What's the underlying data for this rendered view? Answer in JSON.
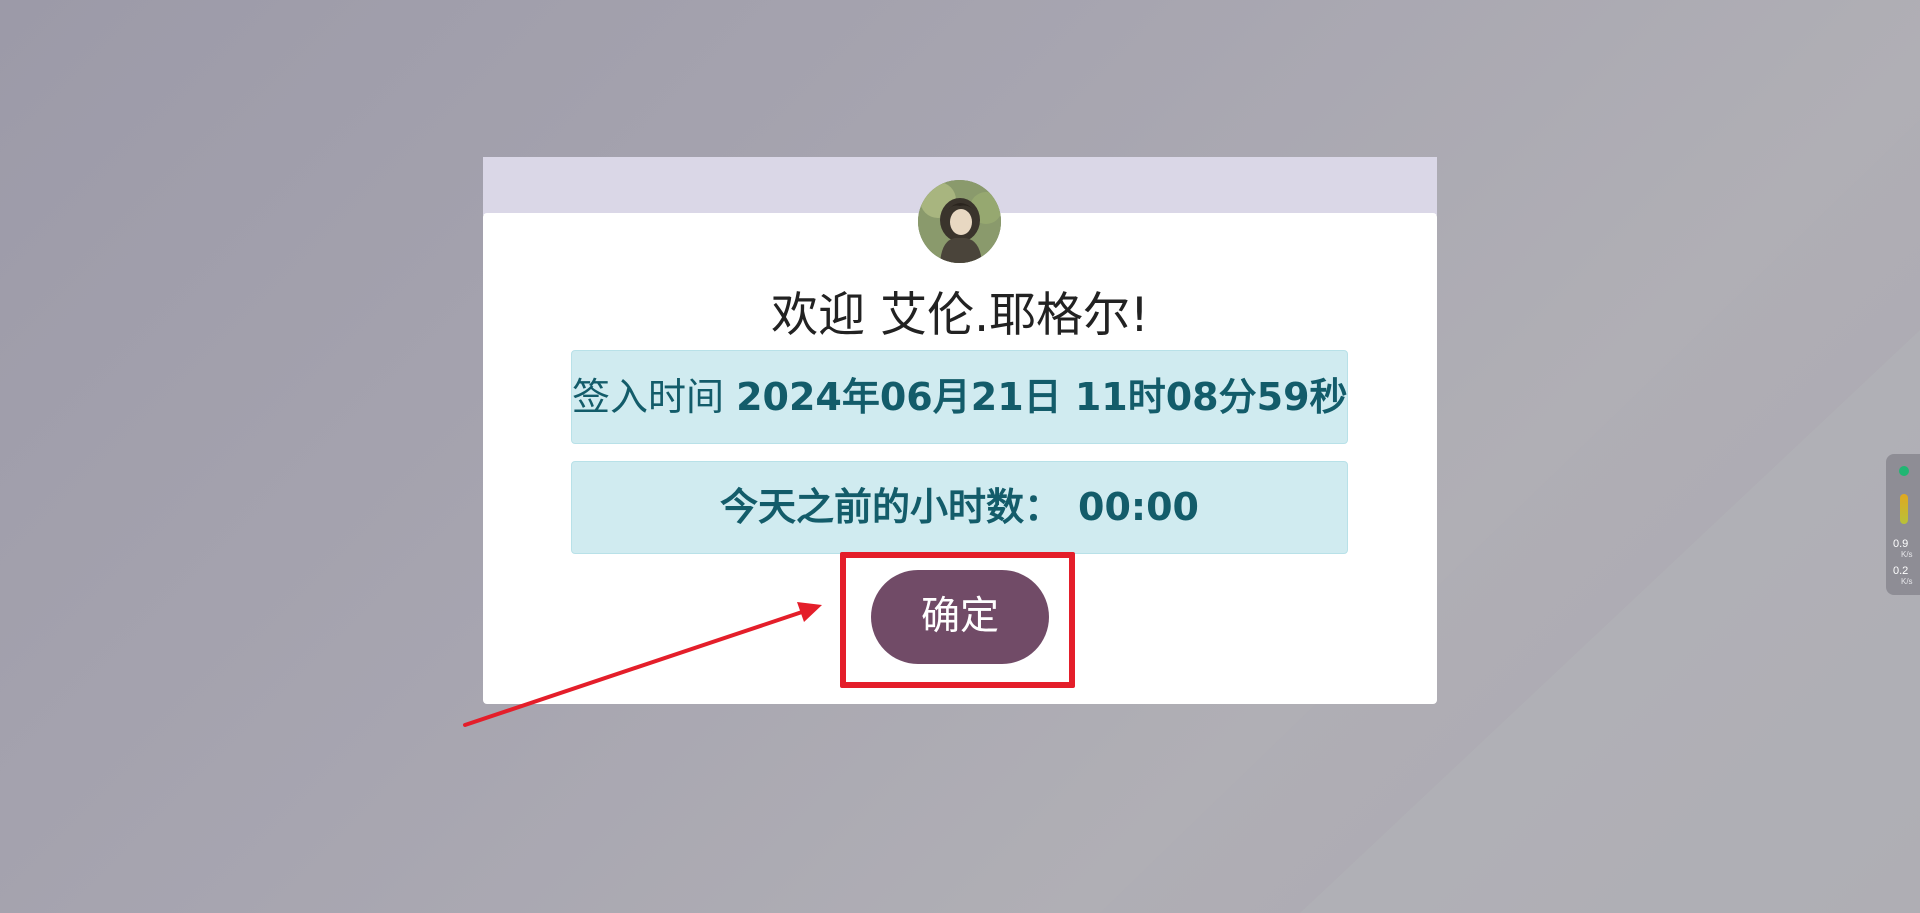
{
  "dialog": {
    "welcome_prefix": "欢迎",
    "user_name": "艾伦.耶格尔!",
    "checkin_label": "签入时间",
    "checkin_value": "2024年06月21日 11时08分59秒",
    "hours_label": "今天之前的小时数：",
    "hours_value": "00:00",
    "confirm_label": "确定"
  },
  "network_widget": {
    "upload_value": "0.9",
    "upload_unit": "K/s",
    "download_value": "0.2",
    "download_unit": "K/s"
  },
  "colors": {
    "accent": "#714b67",
    "info_bg": "#d0ebf0",
    "info_text": "#135c6a",
    "highlight": "#e41e2a",
    "header_band": "#dad7e7"
  },
  "icons": {
    "avatar": "user-avatar",
    "status_dot": "status-dot-icon",
    "level_bar": "level-bar-icon"
  }
}
